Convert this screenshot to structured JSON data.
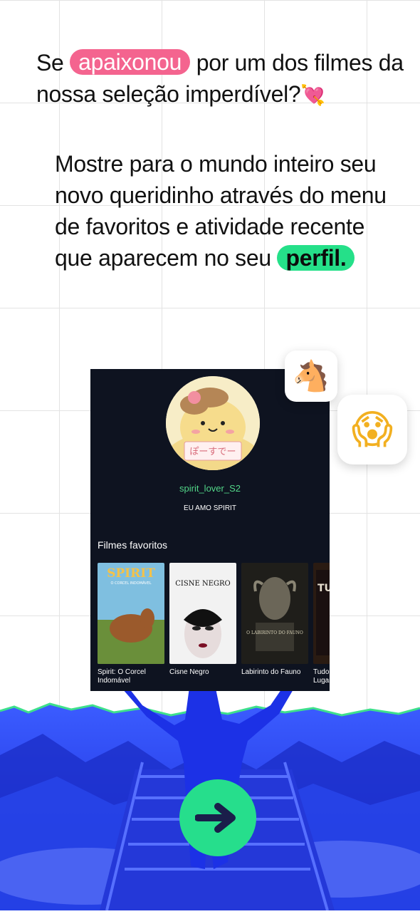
{
  "headline": {
    "before": "Se",
    "highlight": "apaixonou",
    "after": "por um dos filmes da nossa seleção imperdível?",
    "emoji": "💘"
  },
  "body": {
    "text": "Mostre para o mundo inteiro seu novo queridinho através do menu de favoritos e atividade recente que aparecem no seu",
    "highlight": "perfil."
  },
  "profile": {
    "avatar_icon": "pompompurin-avatar",
    "avatar_sign": "ぽーすでー",
    "username": "spirit_lover_S2",
    "bio": "EU AMO SPIRIT",
    "favorites_title": "Filmes favoritos",
    "movies": [
      {
        "label": "Spirit: O Corcel Indomável",
        "poster_title": "SPIRIT",
        "poster_sub": "O CORCEL INDOMÁVEL"
      },
      {
        "label": "Cisne Negro",
        "poster_title": "CISNE NEGRO",
        "poster_sub": ""
      },
      {
        "label": "Labirinto do Fauno",
        "poster_title": "O LABIRINTO DO FAUNO",
        "poster_sub": ""
      },
      {
        "label": "Tudo em Todo o Lugar",
        "poster_title": "TUDO EM TODO",
        "poster_sub": ""
      }
    ]
  },
  "badges": {
    "horse": "🐴",
    "scream": "😱"
  },
  "cta": {
    "icon": "arrow-right-icon",
    "color": "#26de8c"
  },
  "colors": {
    "pink": "#f4648f",
    "green": "#25e089",
    "card_bg": "#0e1320",
    "scene_blue": "#1a33f0"
  }
}
